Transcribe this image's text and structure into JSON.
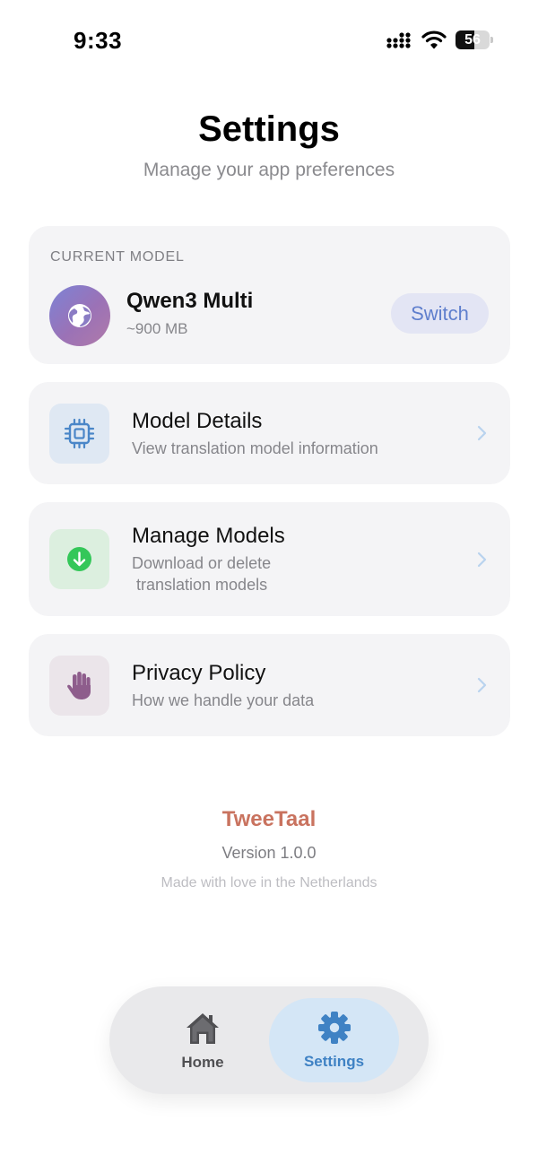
{
  "status_bar": {
    "time": "9:33",
    "battery_level": "56",
    "battery_fraction": 0.56
  },
  "header": {
    "title": "Settings",
    "subtitle": "Manage your app preferences"
  },
  "current_model": {
    "section_label": "CURRENT MODEL",
    "name": "Qwen3 Multi",
    "size": "~900 MB",
    "switch_label": "Switch",
    "icon": "globe-icon"
  },
  "menu": {
    "model_details": {
      "title": "Model Details",
      "description": "View translation model information",
      "icon": "chip-icon"
    },
    "manage_models": {
      "title": "Manage Models",
      "description": "Download or delete\n translation models",
      "icon": "download-icon"
    },
    "privacy_policy": {
      "title": "Privacy Policy",
      "description": "How we handle your data",
      "icon": "hand-icon"
    }
  },
  "footer": {
    "brand": "TweeTaal",
    "version": "Version 1.0.0",
    "tagline": "Made with love in the Netherlands"
  },
  "tab_bar": {
    "home_label": "Home",
    "settings_label": "Settings",
    "active_tab": "Settings"
  },
  "colors": {
    "accent_blue": "#5f7fcd",
    "brand": "#c9735f",
    "active_tab_text": "#3f82c4",
    "download_green": "#34c759",
    "privacy_purple": "#8e5d8c"
  }
}
